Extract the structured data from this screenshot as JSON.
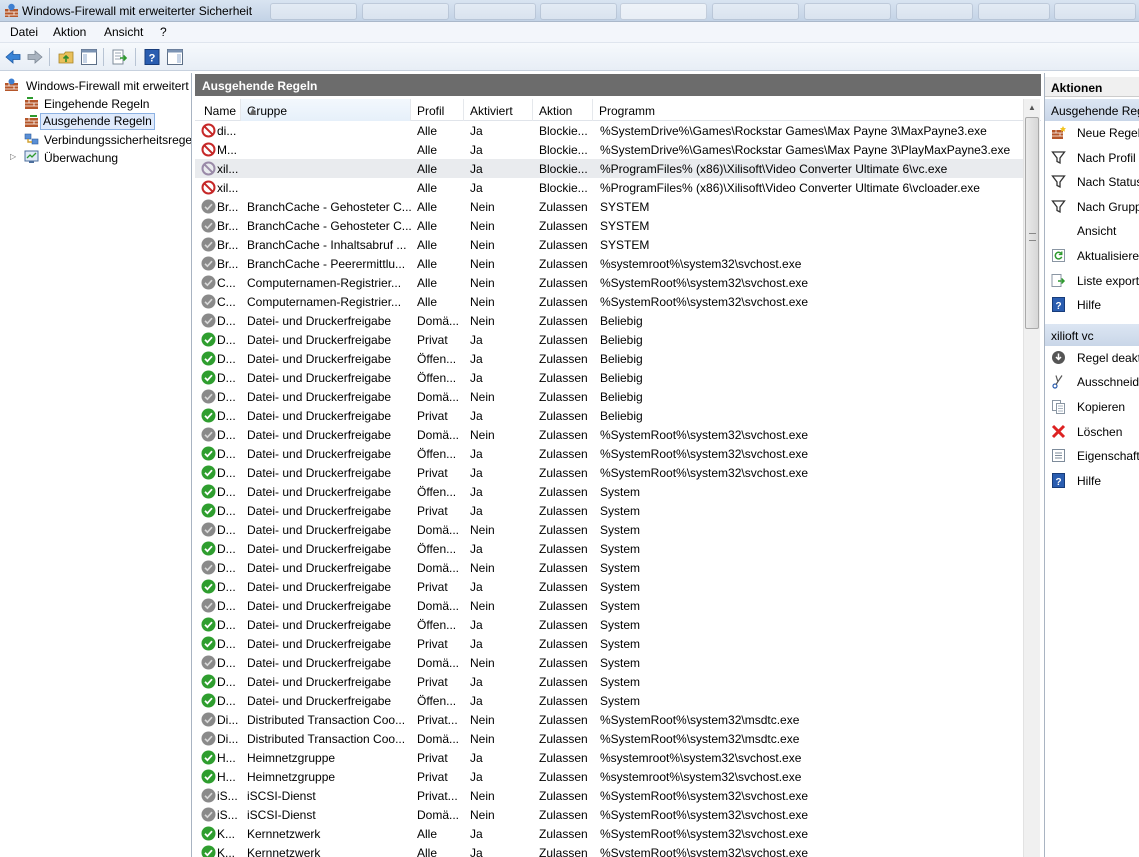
{
  "window": {
    "title": "Windows-Firewall mit erweiterter Sicherheit"
  },
  "menu": [
    "Datei",
    "Aktion",
    "Ansicht",
    "?"
  ],
  "tree": [
    {
      "label": "Windows-Firewall mit erweitert",
      "icon": "firewall-icon"
    },
    {
      "label": "Eingehende Regeln",
      "icon": "inbound-rules-icon"
    },
    {
      "label": "Ausgehende Regeln",
      "icon": "outbound-rules-icon",
      "selected": true
    },
    {
      "label": "Verbindungssicherheitsrege",
      "icon": "connection-security-icon"
    },
    {
      "label": "Überwachung",
      "icon": "monitoring-icon",
      "expandable": true
    }
  ],
  "center": {
    "header": "Ausgehende Regeln",
    "columns": [
      "Name",
      "Gruppe",
      "Profil",
      "Aktiviert",
      "Aktion",
      "Programm"
    ],
    "rows": [
      [
        "block",
        "di...",
        "",
        "Alle",
        "Ja",
        "Blockie...",
        "%SystemDrive%\\Games\\Rockstar Games\\Max Payne 3\\MaxPayne3.exe"
      ],
      [
        "block",
        "M...",
        "",
        "Alle",
        "Ja",
        "Blockie...",
        "%SystemDrive%\\Games\\Rockstar Games\\Max Payne 3\\PlayMaxPayne3.exe"
      ],
      [
        "block-gray",
        "xil...",
        "",
        "Alle",
        "Ja",
        "Blockie...",
        "%ProgramFiles% (x86)\\Xilisoft\\Video Converter Ultimate 6\\vc.exe"
      ],
      [
        "block",
        "xil...",
        "",
        "Alle",
        "Ja",
        "Blockie...",
        "%ProgramFiles% (x86)\\Xilisoft\\Video Converter Ultimate 6\\vcloader.exe"
      ],
      [
        "gray",
        "Br...",
        "BranchCache - Gehosteter C...",
        "Alle",
        "Nein",
        "Zulassen",
        "SYSTEM"
      ],
      [
        "gray",
        "Br...",
        "BranchCache - Gehosteter C...",
        "Alle",
        "Nein",
        "Zulassen",
        "SYSTEM"
      ],
      [
        "gray",
        "Br...",
        "BranchCache - Inhaltsabruf ...",
        "Alle",
        "Nein",
        "Zulassen",
        "SYSTEM"
      ],
      [
        "gray",
        "Br...",
        "BranchCache - Peerermittlu...",
        "Alle",
        "Nein",
        "Zulassen",
        "%systemroot%\\system32\\svchost.exe"
      ],
      [
        "gray",
        "C...",
        "Computernamen-Registrier...",
        "Alle",
        "Nein",
        "Zulassen",
        "%SystemRoot%\\system32\\svchost.exe"
      ],
      [
        "gray",
        "C...",
        "Computernamen-Registrier...",
        "Alle",
        "Nein",
        "Zulassen",
        "%SystemRoot%\\system32\\svchost.exe"
      ],
      [
        "gray",
        "D...",
        "Datei- und Druckerfreigabe",
        "Domä...",
        "Nein",
        "Zulassen",
        "Beliebig"
      ],
      [
        "green",
        "D...",
        "Datei- und Druckerfreigabe",
        "Privat",
        "Ja",
        "Zulassen",
        "Beliebig"
      ],
      [
        "green",
        "D...",
        "Datei- und Druckerfreigabe",
        "Öffen...",
        "Ja",
        "Zulassen",
        "Beliebig"
      ],
      [
        "green",
        "D...",
        "Datei- und Druckerfreigabe",
        "Öffen...",
        "Ja",
        "Zulassen",
        "Beliebig"
      ],
      [
        "gray",
        "D...",
        "Datei- und Druckerfreigabe",
        "Domä...",
        "Nein",
        "Zulassen",
        "Beliebig"
      ],
      [
        "green",
        "D...",
        "Datei- und Druckerfreigabe",
        "Privat",
        "Ja",
        "Zulassen",
        "Beliebig"
      ],
      [
        "gray",
        "D...",
        "Datei- und Druckerfreigabe",
        "Domä...",
        "Nein",
        "Zulassen",
        "%SystemRoot%\\system32\\svchost.exe"
      ],
      [
        "green",
        "D...",
        "Datei- und Druckerfreigabe",
        "Öffen...",
        "Ja",
        "Zulassen",
        "%SystemRoot%\\system32\\svchost.exe"
      ],
      [
        "green",
        "D...",
        "Datei- und Druckerfreigabe",
        "Privat",
        "Ja",
        "Zulassen",
        "%SystemRoot%\\system32\\svchost.exe"
      ],
      [
        "green",
        "D...",
        "Datei- und Druckerfreigabe",
        "Öffen...",
        "Ja",
        "Zulassen",
        "System"
      ],
      [
        "green",
        "D...",
        "Datei- und Druckerfreigabe",
        "Privat",
        "Ja",
        "Zulassen",
        "System"
      ],
      [
        "gray",
        "D...",
        "Datei- und Druckerfreigabe",
        "Domä...",
        "Nein",
        "Zulassen",
        "System"
      ],
      [
        "green",
        "D...",
        "Datei- und Druckerfreigabe",
        "Öffen...",
        "Ja",
        "Zulassen",
        "System"
      ],
      [
        "gray",
        "D...",
        "Datei- und Druckerfreigabe",
        "Domä...",
        "Nein",
        "Zulassen",
        "System"
      ],
      [
        "green",
        "D...",
        "Datei- und Druckerfreigabe",
        "Privat",
        "Ja",
        "Zulassen",
        "System"
      ],
      [
        "gray",
        "D...",
        "Datei- und Druckerfreigabe",
        "Domä...",
        "Nein",
        "Zulassen",
        "System"
      ],
      [
        "green",
        "D...",
        "Datei- und Druckerfreigabe",
        "Öffen...",
        "Ja",
        "Zulassen",
        "System"
      ],
      [
        "green",
        "D...",
        "Datei- und Druckerfreigabe",
        "Privat",
        "Ja",
        "Zulassen",
        "System"
      ],
      [
        "gray",
        "D...",
        "Datei- und Druckerfreigabe",
        "Domä...",
        "Nein",
        "Zulassen",
        "System"
      ],
      [
        "green",
        "D...",
        "Datei- und Druckerfreigabe",
        "Privat",
        "Ja",
        "Zulassen",
        "System"
      ],
      [
        "green",
        "D...",
        "Datei- und Druckerfreigabe",
        "Öffen...",
        "Ja",
        "Zulassen",
        "System"
      ],
      [
        "gray",
        "Di...",
        "Distributed Transaction Coo...",
        "Privat...",
        "Nein",
        "Zulassen",
        "%SystemRoot%\\system32\\msdtc.exe"
      ],
      [
        "gray",
        "Di...",
        "Distributed Transaction Coo...",
        "Domä...",
        "Nein",
        "Zulassen",
        "%SystemRoot%\\system32\\msdtc.exe"
      ],
      [
        "green",
        "H...",
        "Heimnetzgruppe",
        "Privat",
        "Ja",
        "Zulassen",
        "%systemroot%\\system32\\svchost.exe"
      ],
      [
        "green",
        "H...",
        "Heimnetzgruppe",
        "Privat",
        "Ja",
        "Zulassen",
        "%systemroot%\\system32\\svchost.exe"
      ],
      [
        "gray",
        "iS...",
        "iSCSI-Dienst",
        "Privat...",
        "Nein",
        "Zulassen",
        "%SystemRoot%\\system32\\svchost.exe"
      ],
      [
        "gray",
        "iS...",
        "iSCSI-Dienst",
        "Domä...",
        "Nein",
        "Zulassen",
        "%SystemRoot%\\system32\\svchost.exe"
      ],
      [
        "green",
        "K...",
        "Kernnetzwerk",
        "Alle",
        "Ja",
        "Zulassen",
        "%SystemRoot%\\system32\\svchost.exe"
      ],
      [
        "green",
        "K...",
        "Kernnetzwerk",
        "Alle",
        "Ja",
        "Zulassen",
        "%SystemRoot%\\system32\\svchost.exe"
      ]
    ],
    "highlighted_row": 2
  },
  "actions": {
    "title": "Aktionen",
    "sections": [
      {
        "label": "Ausgehende Regeln",
        "items": [
          {
            "label": "Neue Regel...",
            "icon": "new-rule-icon"
          },
          {
            "label": "Nach Profil filtern",
            "icon": "filter-icon"
          },
          {
            "label": "Nach Status filtern",
            "icon": "filter-icon"
          },
          {
            "label": "Nach Gruppe filtern",
            "icon": "filter-icon"
          },
          {
            "label": "Ansicht",
            "icon": ""
          },
          {
            "label": "Aktualisieren",
            "icon": "refresh-icon"
          },
          {
            "label": "Liste exportieren...",
            "icon": "export-icon"
          },
          {
            "label": "Hilfe",
            "icon": "help-icon"
          }
        ]
      },
      {
        "label": "xilioft vc",
        "items": [
          {
            "label": "Regel deaktivieren",
            "icon": "disable-icon"
          },
          {
            "label": "Ausschneiden",
            "icon": "cut-icon"
          },
          {
            "label": "Kopieren",
            "icon": "copy-icon"
          },
          {
            "label": "Löschen",
            "icon": "delete-icon"
          },
          {
            "label": "Eigenschaften",
            "icon": "properties-icon"
          },
          {
            "label": "Hilfe",
            "icon": "help-icon"
          }
        ]
      }
    ]
  },
  "colors": {
    "allow": "#2f9e2f",
    "block": "#c62828",
    "disabled": "#8a8a8a",
    "header_bg": "#6c6c6c"
  }
}
